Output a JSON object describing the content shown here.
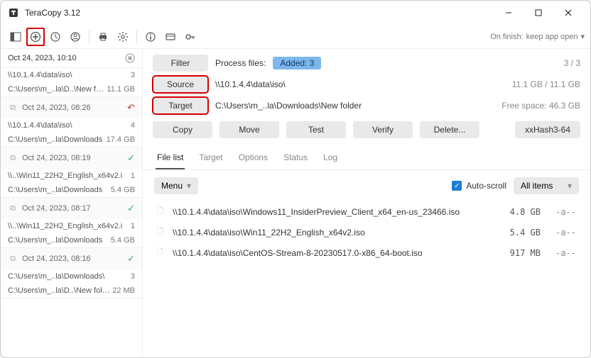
{
  "window": {
    "title": "TeraCopy 3.12"
  },
  "toolbar": {
    "on_finish_label": "On finish:",
    "on_finish_value": "keep app open"
  },
  "sidebar": {
    "current": {
      "when": "Oct 24, 2023, 10:10",
      "src": "\\\\10.1.4.4\\data\\iso\\",
      "src_count": "3",
      "dst": "C:\\Users\\m_..la\\D..\\New folder",
      "dst_size": "11.1 GB"
    },
    "history": [
      {
        "when": "Oct 24, 2023, 08:26",
        "status": "undo",
        "src": "\\\\10.1.4.4\\data\\iso\\",
        "src_count": "4",
        "dst": "C:\\Users\\m_..la\\Downloads",
        "dst_size": "17.4 GB"
      },
      {
        "when": "Oct 24, 2023, 08:19",
        "status": "done",
        "src": "\\\\..\\Win11_22H2_English_x64v2.i",
        "src_count": "1",
        "dst": "C:\\Users\\m_..la\\Downloads",
        "dst_size": "5.4 GB"
      },
      {
        "when": "Oct 24, 2023, 08:17",
        "status": "done",
        "src": "\\\\..\\Win11_22H2_English_x64v2.i",
        "src_count": "1",
        "dst": "C:\\Users\\m_..la\\Downloads",
        "dst_size": "5.4 GB"
      },
      {
        "when": "Oct 24, 2023, 08:16",
        "status": "done",
        "src": "C:\\Users\\m_..la\\Downloads\\",
        "src_count": "3",
        "dst": "C:\\Users\\m_..la\\D..\\New folder",
        "dst_size": "22 MB"
      }
    ]
  },
  "controls": {
    "filter_label": "Filter",
    "process_label": "Process files:",
    "added_badge": "Added: 3",
    "counter": "3 / 3",
    "source_label": "Source",
    "source_path": "\\\\10.1.4.4\\data\\iso\\",
    "source_size": "11.1 GB / 11.1 GB",
    "target_label": "Target",
    "target_path": "C:\\Users\\m_..la\\Downloads\\New folder",
    "target_free": "Free space: 46.3 GB"
  },
  "actions": {
    "copy": "Copy",
    "move": "Move",
    "test": "Test",
    "verify": "Verify",
    "delete": "Delete...",
    "hash": "xxHash3-64"
  },
  "tabs": {
    "filelist": "File list",
    "target": "Target",
    "options": "Options",
    "status": "Status",
    "log": "Log"
  },
  "listtools": {
    "menu": "Menu",
    "autoscroll": "Auto-scroll",
    "filter": "All items"
  },
  "files": [
    {
      "name": "\\\\10.1.4.4\\data\\iso\\Windows11_InsiderPreview_Client_x64_en-us_23466.iso",
      "size": "4.8 GB",
      "attr": "-a--"
    },
    {
      "name": "\\\\10.1.4.4\\data\\iso\\Win11_22H2_English_x64v2.iso",
      "size": "5.4 GB",
      "attr": "-a--"
    },
    {
      "name": "\\\\10.1.4.4\\data\\iso\\CentOS-Stream-8-20230517.0-x86_64-boot.iso",
      "size": "917 MB",
      "attr": "-a--"
    }
  ]
}
